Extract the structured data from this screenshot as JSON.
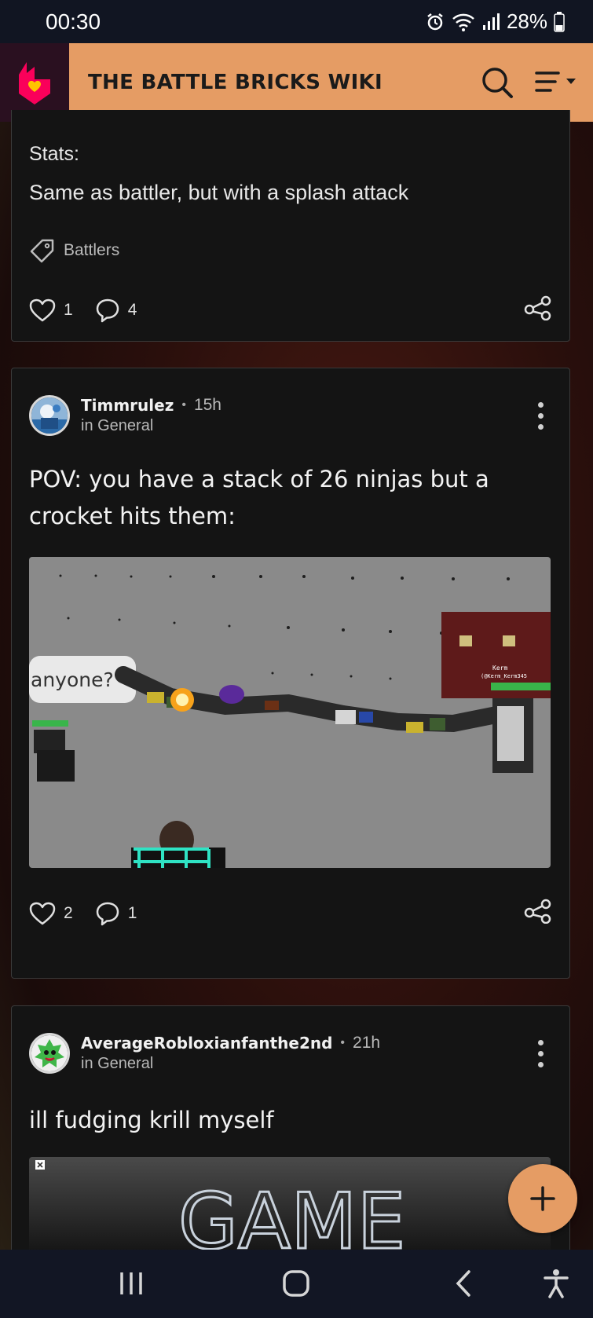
{
  "status_bar": {
    "time": "00:30",
    "battery": "28%"
  },
  "header": {
    "title": "THE BATTLE BRICKS WIKI"
  },
  "post1": {
    "stats_label": "Stats:",
    "stats_text": "Same as battler, but with a splash attack",
    "tag": "Battlers",
    "likes": "1",
    "comments": "4"
  },
  "post2": {
    "author": "Timmrulez",
    "time": "15h",
    "category": "in General",
    "title": "POV: you have a stack of 26 ninjas but a crocket hits them:",
    "media_bubble": "anyone?",
    "media_tag_right": "Kerm",
    "media_tag_right_sub": "(@Kerm_Kerm345",
    "likes": "2",
    "comments": "1"
  },
  "post3": {
    "author": "AverageRobloxianfanthe2nd",
    "time": "21h",
    "category": "in General",
    "title": "ill fudging krill myself",
    "media_text": "GAME"
  },
  "icons": {
    "logo": "fandom-heart-icon",
    "search": "search-icon",
    "menu": "menu-icon",
    "like": "heart-icon",
    "comment": "comment-icon",
    "share": "share-icon",
    "tag": "tag-icon",
    "more": "more-vertical-icon",
    "fab": "plus-icon"
  },
  "colors": {
    "accent": "#e59c64",
    "card": "#141414",
    "status_bar": "#111522"
  }
}
